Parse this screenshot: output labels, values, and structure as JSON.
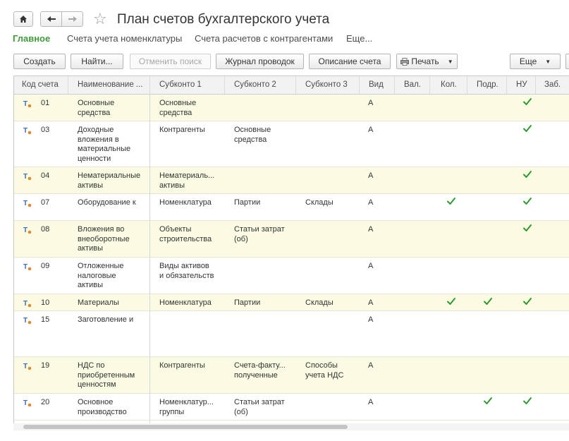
{
  "window": {
    "title": "План счетов бухгалтерского учета"
  },
  "icons": {
    "home": "home-icon",
    "back": "arrow-left-icon",
    "forward": "arrow-right-icon",
    "favorite": "star-icon",
    "print": "printer-icon",
    "account": "account-type-icon",
    "check": "checkmark-icon"
  },
  "colors": {
    "accent": "#3f9a3a",
    "row_highlight": "#fbfbe3",
    "check": "#2f9a2f"
  },
  "tabs": [
    "Главное",
    "Счета учета номенклатуры",
    "Счета расчетов с контрагентами",
    "Еще..."
  ],
  "toolbar": {
    "create": "Создать",
    "find": "Найти...",
    "cancel_search": "Отменить поиск",
    "journal": "Журнал проводок",
    "description": "Описание счета",
    "print": "Печать",
    "more": "Еще"
  },
  "columns": [
    "Код счета",
    "Наименование ...",
    "Субконто 1",
    "Субконто 2",
    "Субконто 3",
    "Вид",
    "Вал.",
    "Кол.",
    "Подр.",
    "НУ",
    "Заб."
  ],
  "rows": [
    {
      "code": "01",
      "name": "Основные\nсредства",
      "s1": "Основные\nсредства",
      "s2": "",
      "s3": "",
      "kind": "А",
      "cur": false,
      "qty": false,
      "dept": false,
      "nu": true
    },
    {
      "code": "03",
      "name": "Доходные\nвложения в\nматериальные\nценности",
      "s1": "Контрагенты",
      "s2": "Основные\nсредства",
      "s3": "",
      "kind": "А",
      "cur": false,
      "qty": false,
      "dept": false,
      "nu": true
    },
    {
      "code": "04",
      "name": "Нематериальные\nактивы",
      "s1": "Нематериаль...\n активы",
      "s2": "",
      "s3": "",
      "kind": "А",
      "cur": false,
      "qty": false,
      "dept": false,
      "nu": true
    },
    {
      "code": "07",
      "name": "Оборудование к",
      "s1": "Номенклатура",
      "s2": "Партии",
      "s3": "Склады",
      "kind": "А",
      "cur": false,
      "qty": true,
      "dept": false,
      "nu": true
    },
    {
      "code": "08",
      "name": "Вложения во\nвнеоборотные\nактивы",
      "s1": "Объекты\nстроительства",
      "s2": "Статьи затрат\n(об)",
      "s3": "",
      "kind": "А",
      "cur": false,
      "qty": false,
      "dept": false,
      "nu": true
    },
    {
      "code": "09",
      "name": "Отложенные\nналоговые\nактивы",
      "s1": "Виды активов\nи обязательств",
      "s2": "",
      "s3": "",
      "kind": "А",
      "cur": false,
      "qty": false,
      "dept": false,
      "nu": false
    },
    {
      "code": "10",
      "name": "Материалы",
      "s1": "Номенклатура",
      "s2": "Партии",
      "s3": "Склады",
      "kind": "А",
      "cur": false,
      "qty": true,
      "dept": true,
      "nu": true
    },
    {
      "code": "15",
      "name": "Заготовление и",
      "s1": "",
      "s2": "",
      "s3": "",
      "kind": "А",
      "cur": false,
      "qty": false,
      "dept": false,
      "nu": false
    },
    {
      "code": "19",
      "name": "НДС по\nприобретенным\nценностям",
      "s1": "Контрагенты",
      "s2": "Счета-факту...\n полученные",
      "s3": "Способы\nучета НДС",
      "kind": "А",
      "cur": false,
      "qty": false,
      "dept": false,
      "nu": false
    },
    {
      "code": "20",
      "name": "Основное\nпроизводство",
      "s1": "Номенклатур...\n группы",
      "s2": "Статьи затрат\n(об)",
      "s3": "",
      "kind": "А",
      "cur": false,
      "qty": false,
      "dept": true,
      "nu": true
    }
  ]
}
